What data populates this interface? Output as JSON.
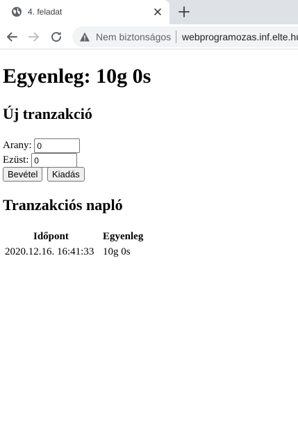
{
  "browser": {
    "tab_title": "4. feladat",
    "security_label": "Nem biztonságos",
    "url": "webprogramozas.inf.elte.hu"
  },
  "page": {
    "heading": "Egyenleg: 10g 0s",
    "new_transaction": {
      "heading": "Új tranzakció",
      "gold_label": "Arany:",
      "gold_value": "0",
      "silver_label": "Ezüst:",
      "silver_value": "0",
      "income_button": "Bevétel",
      "expense_button": "Kiadás"
    },
    "log": {
      "heading": "Tranzakciós napló",
      "columns": [
        "Időpont",
        "Egyenleg"
      ],
      "rows": [
        [
          "2020.12.16. 16:41:33",
          "10g 0s"
        ]
      ]
    }
  }
}
